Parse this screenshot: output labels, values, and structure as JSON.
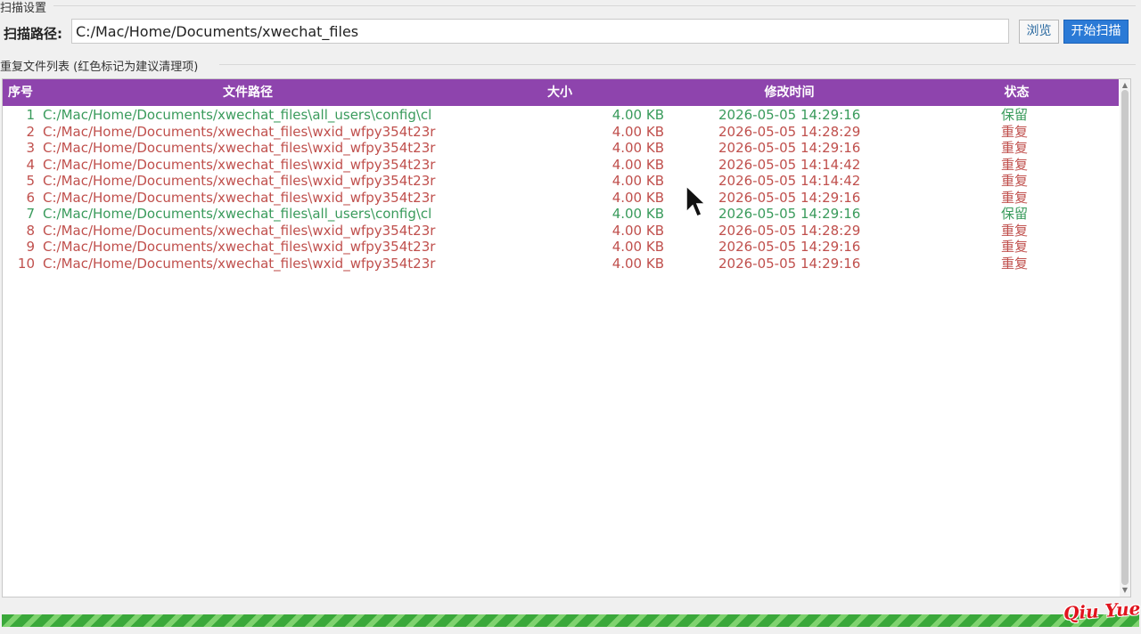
{
  "scan_group": {
    "title": "扫描设置",
    "path_label": "扫描路径:",
    "path_value": "C:/Mac/Home/Documents/xwechat_files",
    "browse_label": "浏览",
    "scan_label": "开始扫描"
  },
  "list_group": {
    "title": "重复文件列表 (红色标记为建议清理项)"
  },
  "table": {
    "headers": {
      "index": "序号",
      "path": "文件路径",
      "size": "大小",
      "modified": "修改时间",
      "status": "状态"
    },
    "rows": [
      {
        "index": "1",
        "path": "C:/Mac/Home/Documents/xwechat_files\\all_users\\config\\cl",
        "size": "4.00 KB",
        "modified": "2026-05-05 14:29:16",
        "status": "保留",
        "color": "#3a9b5c"
      },
      {
        "index": "2",
        "path": "C:/Mac/Home/Documents/xwechat_files\\wxid_wfpy354t23r",
        "size": "4.00 KB",
        "modified": "2026-05-05 14:28:29",
        "status": "重复",
        "color": "#c0504d"
      },
      {
        "index": "3",
        "path": "C:/Mac/Home/Documents/xwechat_files\\wxid_wfpy354t23r",
        "size": "4.00 KB",
        "modified": "2026-05-05 14:29:16",
        "status": "重复",
        "color": "#c0504d"
      },
      {
        "index": "4",
        "path": "C:/Mac/Home/Documents/xwechat_files\\wxid_wfpy354t23r",
        "size": "4.00 KB",
        "modified": "2026-05-05 14:14:42",
        "status": "重复",
        "color": "#c0504d"
      },
      {
        "index": "5",
        "path": "C:/Mac/Home/Documents/xwechat_files\\wxid_wfpy354t23r",
        "size": "4.00 KB",
        "modified": "2026-05-05 14:14:42",
        "status": "重复",
        "color": "#c0504d"
      },
      {
        "index": "6",
        "path": "C:/Mac/Home/Documents/xwechat_files\\wxid_wfpy354t23r",
        "size": "4.00 KB",
        "modified": "2026-05-05 14:29:16",
        "status": "重复",
        "color": "#c0504d"
      },
      {
        "index": "7",
        "path": "C:/Mac/Home/Documents/xwechat_files\\all_users\\config\\cl",
        "size": "4.00 KB",
        "modified": "2026-05-05 14:29:16",
        "status": "保留",
        "color": "#3a9b5c"
      },
      {
        "index": "8",
        "path": "C:/Mac/Home/Documents/xwechat_files\\wxid_wfpy354t23r",
        "size": "4.00 KB",
        "modified": "2026-05-05 14:28:29",
        "status": "重复",
        "color": "#c0504d"
      },
      {
        "index": "9",
        "path": "C:/Mac/Home/Documents/xwechat_files\\wxid_wfpy354t23r",
        "size": "4.00 KB",
        "modified": "2026-05-05 14:29:16",
        "status": "重复",
        "color": "#c0504d"
      },
      {
        "index": "10",
        "path": "C:/Mac/Home/Documents/xwechat_files\\wxid_wfpy354t23r",
        "size": "4.00 KB",
        "modified": "2026-05-05 14:29:16",
        "status": "重复",
        "color": "#c0504d"
      }
    ]
  },
  "progress": {
    "value": 1.0,
    "color": "#3aa83a"
  },
  "watermark": "Qiu Yue",
  "colors": {
    "header_bg": "#8e44ad",
    "keep": "#3a9b5c",
    "duplicate": "#c0504d",
    "accent": "#2b7ad6"
  }
}
